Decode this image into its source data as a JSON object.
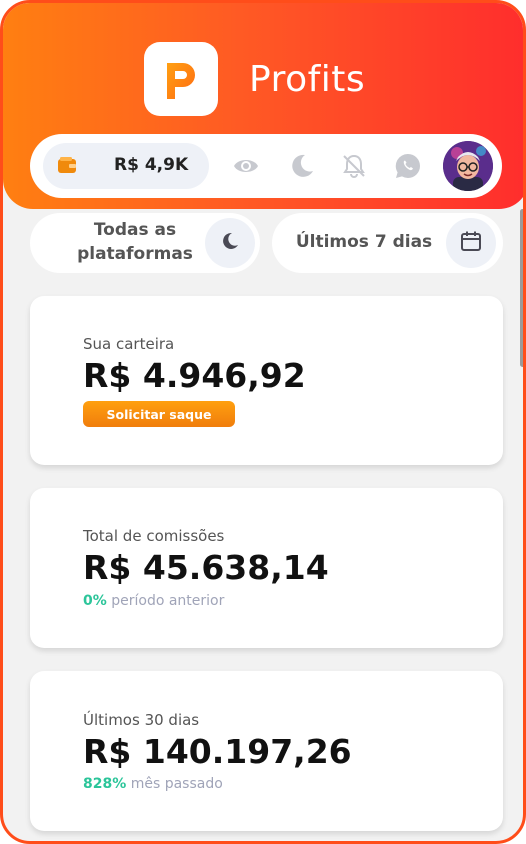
{
  "app": {
    "title": "Profits"
  },
  "toolbar": {
    "wallet_amount": "R$ 4,9K",
    "icons": [
      "wallet-icon",
      "eye-icon",
      "moon-icon",
      "bell-off-icon",
      "whatsapp-icon",
      "avatar"
    ]
  },
  "filters": {
    "platforms_line1": "Todas as",
    "platforms_line2": "plataformas",
    "period": "Últimos 7 dias"
  },
  "cards": {
    "wallet": {
      "label": "Sua carteira",
      "value": "R$ 4.946,92",
      "button": "Solicitar saque"
    },
    "commissions": {
      "label": "Total de comissões",
      "value": "R$ 45.638,14",
      "percent": "0%",
      "compare": "período anterior"
    },
    "last30": {
      "label": "Últimos 30 dias",
      "value": "R$ 140.197,26",
      "percent": "828%",
      "compare": "mês passado"
    }
  },
  "colors": {
    "header_start": "#ff7f11",
    "header_end": "#ff2d2d",
    "accent": "#f07d0c",
    "positive": "#2cc59a"
  }
}
